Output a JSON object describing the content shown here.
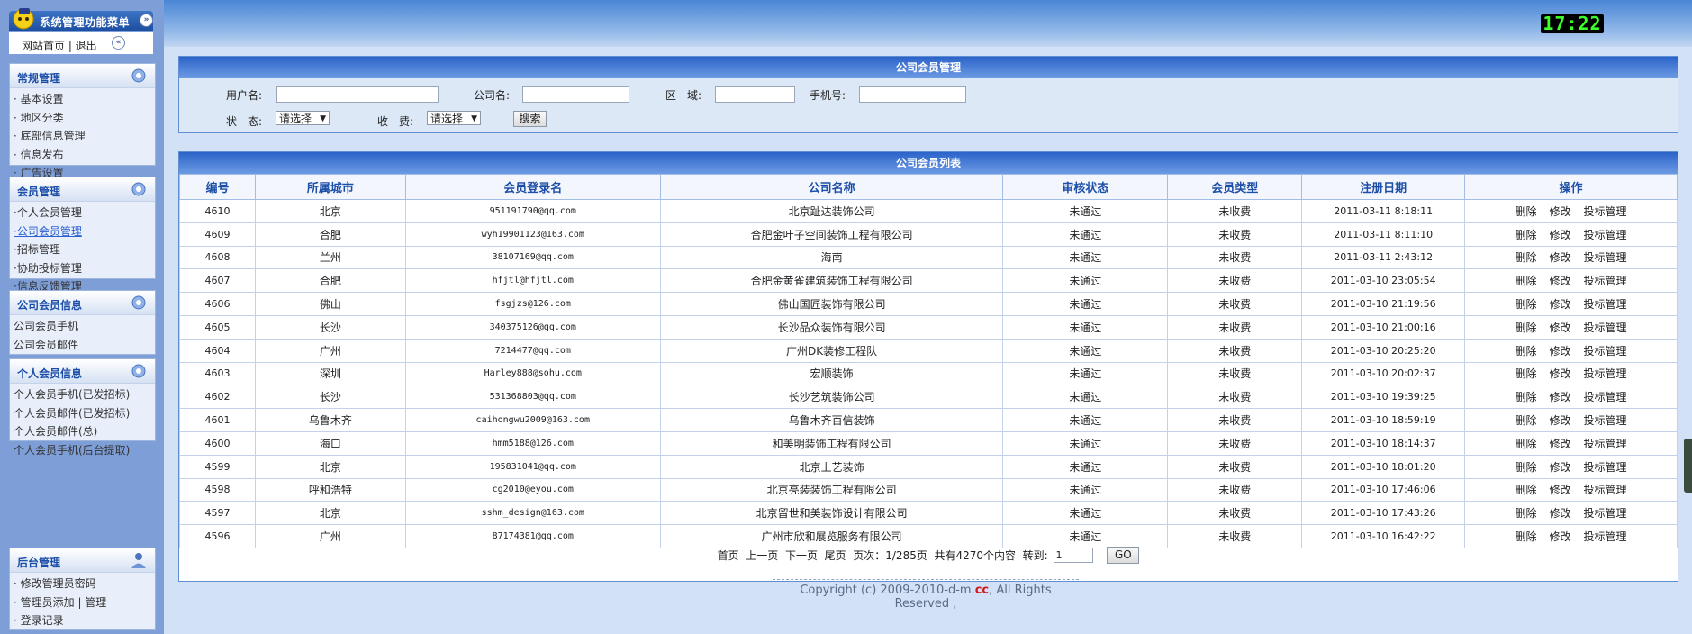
{
  "sidebar": {
    "title": "系统管理功能菜单",
    "links": "网站首页 | 退出",
    "sections": [
      {
        "title": "常规管理",
        "icon": "gear-icon",
        "items": [
          "· 基本设置",
          "· 地区分类",
          "· 底部信息管理",
          "· 信息发布",
          "· 广告设置"
        ]
      },
      {
        "title": "会员管理",
        "icon": "gear-icon",
        "items": [
          "·个人会员管理",
          "·公司会员管理",
          "·招标管理",
          "·协助投标管理",
          "·信息反馈管理"
        ]
      },
      {
        "title": "公司会员信息",
        "icon": "gear-icon",
        "items": [
          "公司会员手机",
          "公司会员邮件"
        ]
      },
      {
        "title": "个人会员信息",
        "icon": "gear-icon",
        "items": [
          "个人会员手机(已发招标)",
          "个人会员邮件(已发招标)",
          "个人会员邮件(总)",
          "个人会员手机(后台提取)"
        ]
      },
      {
        "title": "后台管理",
        "icon": "admin-user-icon",
        "items": [
          "· 修改管理员密码",
          "· 管理员添加 | 管理",
          "· 登录记录"
        ]
      }
    ]
  },
  "header": {
    "clock": "17:22"
  },
  "search": {
    "title": "公司会员管理",
    "username_label": "用户名:",
    "company_label": "公司名:",
    "region_label": "区　域:",
    "phone_label": "手机号:",
    "status_label": "状　态:",
    "status_value": "请选择",
    "fee_label": "收　费:",
    "fee_value": "请选择",
    "search_button": "搜索"
  },
  "list": {
    "title": "公司会员列表",
    "columns": [
      "编号",
      "所属城市",
      "会员登录名",
      "公司名称",
      "审核状态",
      "会员类型",
      "注册日期",
      "操作"
    ],
    "actions": [
      "删除",
      "修改",
      "投标管理"
    ],
    "rows": [
      [
        "4610",
        "北京",
        "951191790@qq.com",
        "北京趾达装饰公司",
        "未通过",
        "未收费",
        "2011-03-11 8:18:11"
      ],
      [
        "4609",
        "合肥",
        "wyh19901123@163.com",
        "合肥金叶子空间装饰工程有限公司",
        "未通过",
        "未收费",
        "2011-03-11 8:11:10"
      ],
      [
        "4608",
        "兰州",
        "38107169@qq.com",
        "海南",
        "未通过",
        "未收费",
        "2011-03-11 2:43:12"
      ],
      [
        "4607",
        "合肥",
        "hfjtl@hfjtl.com",
        "合肥金黄雀建筑装饰工程有限公司",
        "未通过",
        "未收费",
        "2011-03-10 23:05:54"
      ],
      [
        "4606",
        "佛山",
        "fsgjzs@126.com",
        "佛山国匠装饰有限公司",
        "未通过",
        "未收费",
        "2011-03-10 21:19:56"
      ],
      [
        "4605",
        "长沙",
        "340375126@qq.com",
        "长沙品众装饰有限公司",
        "未通过",
        "未收费",
        "2011-03-10 21:00:16"
      ],
      [
        "4604",
        "广州",
        "7214477@qq.com",
        "广州DK装修工程队",
        "未通过",
        "未收费",
        "2011-03-10 20:25:20"
      ],
      [
        "4603",
        "深圳",
        "Harley888@sohu.com",
        "宏顺装饰",
        "未通过",
        "未收费",
        "2011-03-10 20:02:37"
      ],
      [
        "4602",
        "长沙",
        "531368803@qq.com",
        "长沙艺筑装饰公司",
        "未通过",
        "未收费",
        "2011-03-10 19:39:25"
      ],
      [
        "4601",
        "乌鲁木齐",
        "caihongwu2009@163.com",
        "乌鲁木齐百信装饰",
        "未通过",
        "未收费",
        "2011-03-10 18:59:19"
      ],
      [
        "4600",
        "海口",
        "hmm5188@126.com",
        "和美明装饰工程有限公司",
        "未通过",
        "未收费",
        "2011-03-10 18:14:37"
      ],
      [
        "4599",
        "北京",
        "195831041@qq.com",
        "北京上艺装饰",
        "未通过",
        "未收费",
        "2011-03-10 18:01:20"
      ],
      [
        "4598",
        "呼和浩特",
        "cg2010@eyou.com",
        "北京亮装装饰工程有限公司",
        "未通过",
        "未收费",
        "2011-03-10 17:46:06"
      ],
      [
        "4597",
        "北京",
        "sshm_design@163.com",
        "北京留世和美装饰设计有限公司",
        "未通过",
        "未收费",
        "2011-03-10 17:43:26"
      ],
      [
        "4596",
        "广州",
        "87174381@qq.com",
        "广州市欣和展览服务有限公司",
        "未通过",
        "未收费",
        "2011-03-10 16:42:22"
      ]
    ]
  },
  "pager": {
    "first": "首页",
    "prev": "上一页",
    "next": "下一页",
    "last": "尾页",
    "pages": "页次：1/285页",
    "total": "共有4270个内容",
    "goto_label": "转到:",
    "goto_value": "1",
    "go_button": "GO"
  },
  "footer": {
    "prefix": "Copyright (c) 2009-2010-d-m.",
    "cc": "cc",
    "suffix": ", All Rights Reserved ,"
  }
}
